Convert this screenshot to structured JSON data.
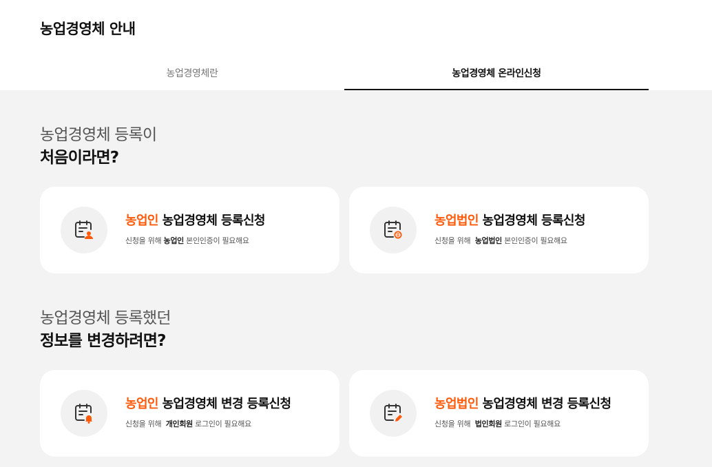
{
  "header": {
    "title": "농업경영체 안내"
  },
  "tabs": [
    {
      "label": "농업경영체란"
    },
    {
      "label": "농업경영체 온라인신청"
    }
  ],
  "sections": [
    {
      "light": "농업경영체 등록이",
      "bold": "처음이라면?"
    },
    {
      "light": "농업경영체 등록했던",
      "bold": "정보를 변경하려면?"
    }
  ],
  "cards": [
    {
      "accent": "농업인",
      "title": "농업경영체 등록신청",
      "desc_pre": "신청을 위해 ",
      "desc_em": "농업인",
      "desc_post": " 본인인증이 필요해요",
      "icon": "calendar-person-icon"
    },
    {
      "accent": "농업법인",
      "title": "농업경영체 등록신청",
      "desc_pre": "신청을 위해  ",
      "desc_em": "농업법인",
      "desc_post": " 본인인증이 필요해요",
      "icon": "calendar-corporation-icon"
    },
    {
      "accent": "농업인",
      "title": "농업경영체 변경 등록신청",
      "desc_pre": "신청을 위해  ",
      "desc_em": "개인회원",
      "desc_post": " 로그인이 필요해요",
      "icon": "calendar-bell-icon"
    },
    {
      "accent": "농업법인",
      "title": "농업경영체 변경 등록신청",
      "desc_pre": "신청을 위해  ",
      "desc_em": "법인회원",
      "desc_post": " 로그인이 필요해요",
      "icon": "calendar-edit-icon"
    }
  ],
  "colors": {
    "accent": "#ff5a0a",
    "background": "#f3f3f3",
    "card": "#ffffff",
    "icon_circle": "#f1f1f1"
  }
}
